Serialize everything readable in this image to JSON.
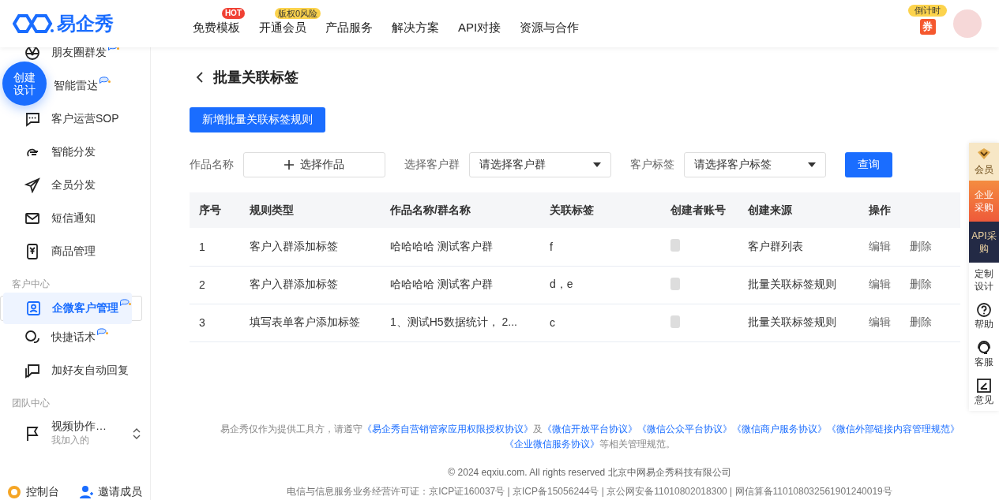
{
  "brand": {
    "name": "易企秀"
  },
  "nav": [
    {
      "label": "免费模板",
      "badge": {
        "text": "HOT",
        "kind": "hot"
      }
    },
    {
      "label": "开通会员",
      "badge": {
        "text": "版权0风险",
        "kind": "promo"
      }
    },
    {
      "label": "产品服务"
    },
    {
      "label": "解决方案"
    },
    {
      "label": "API对接"
    },
    {
      "label": "资源与合作"
    }
  ],
  "header_right": {
    "countdown": "倒计时",
    "coupon": "券"
  },
  "create_button": "创建设计",
  "sidebar": {
    "sections": [
      {
        "items": [
          {
            "label": "朋友圈群发",
            "selected": false,
            "ai_badge": true
          },
          {
            "label": "智能雷达",
            "selected": false,
            "ai_badge": true
          },
          {
            "label": "客户运营SOP",
            "selected": false,
            "ai_badge": false
          },
          {
            "label": "智能分发",
            "selected": false,
            "ai_badge": false
          },
          {
            "label": "全员分发",
            "selected": false,
            "ai_badge": false
          },
          {
            "label": "短信通知",
            "selected": false,
            "ai_badge": false
          },
          {
            "label": "商品管理",
            "selected": false,
            "ai_badge": false
          }
        ]
      },
      {
        "title": "客户中心",
        "items": [
          {
            "label": "企微客户管理",
            "selected": true,
            "ai_badge": true
          },
          {
            "label": "快捷话术",
            "selected": false,
            "ai_badge": true
          },
          {
            "label": "加好友自动回复",
            "selected": false,
            "ai_badge": false
          }
        ]
      },
      {
        "title": "团队中心",
        "team": {
          "label": "视频协作…",
          "sub": "我加入的"
        }
      }
    ],
    "footer": [
      {
        "label": "控制台"
      },
      {
        "label": "邀请成员"
      }
    ]
  },
  "page": {
    "title": "批量关联标签",
    "add_button": "新增批量关联标签规则",
    "filters": [
      {
        "label": "作品名称",
        "kind": "picker",
        "text": "选择作品"
      },
      {
        "label": "选择客户群",
        "kind": "select",
        "placeholder": "请选择客户群"
      },
      {
        "label": "客户标签",
        "kind": "select",
        "placeholder": "请选择客户标签"
      }
    ],
    "query_button": "查询"
  },
  "table": {
    "columns": [
      "序号",
      "规则类型",
      "作品名称/群名称",
      "关联标签",
      "创建者账号",
      "创建来源",
      "操作"
    ],
    "rows": [
      {
        "cells": [
          "1",
          "客户入群添加标签",
          "哈哈哈哈 测试客户群",
          "f",
          {
            "kind": "redacted"
          },
          "客户群列表"
        ],
        "actions": [
          "编辑",
          "删除"
        ]
      },
      {
        "cells": [
          "2",
          "客户入群添加标签",
          "哈哈哈哈 测试客户群",
          "d，e",
          {
            "kind": "redacted"
          },
          "批量关联标签规则"
        ],
        "actions": [
          "编辑",
          "删除"
        ]
      },
      {
        "cells": [
          "3",
          "填写表单客户添加标签",
          "1、测试H5数据统计，  2...",
          "c",
          {
            "kind": "redacted"
          },
          "批量关联标签规则"
        ],
        "actions": [
          "编辑",
          "删除"
        ]
      }
    ]
  },
  "float_bar": [
    {
      "label": "会员",
      "kind": "vip"
    },
    {
      "label": "企业采购",
      "kind": "enterprise"
    },
    {
      "label": "API采购",
      "kind": "api"
    },
    {
      "label": "定制设计",
      "kind": "plain"
    },
    {
      "label": "帮助",
      "kind": "help"
    },
    {
      "label": "客服",
      "kind": "service"
    },
    {
      "label": "意见",
      "kind": "feedback"
    }
  ],
  "site_footer": {
    "notice": [
      {
        "kind": "text",
        "text": "易企秀仅作为提供工具方，请遵守"
      },
      {
        "kind": "link",
        "text": "《易企秀自营销管家应用权限授权协议》"
      },
      {
        "kind": "text",
        "text": "及"
      },
      {
        "kind": "link",
        "text": "《微信开放平台协议》"
      },
      {
        "kind": "link",
        "text": "《微信公众平台协议》"
      },
      {
        "kind": "link",
        "text": "《微信商户服务协议》"
      },
      {
        "kind": "link",
        "text": "《微信外部链接内容管理规范》"
      },
      {
        "kind": "link",
        "text": "《企业微信服务协议》"
      },
      {
        "kind": "text",
        "text": "等相关管理规范。"
      }
    ],
    "copyright": "© 2024 eqxiu.com. All rights reserved 北京中网易企秀科技有限公司",
    "license": "电信与信息服务业务经营许可证：京ICP证160037号 | 京ICP备15056244号 | 京公网安备11010802018300 | 网信算备110108032561901240019号"
  }
}
